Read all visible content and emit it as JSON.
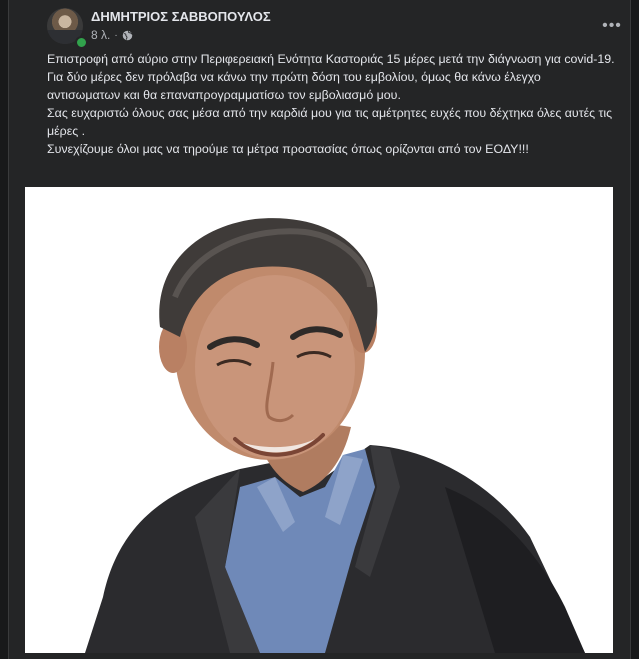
{
  "post": {
    "author": "ΔΗΜΗΤΡΙΟΣ ΣΑΒΒΟΠΟΥΛΟΣ",
    "time": "8 λ.",
    "separator": "·",
    "privacy_icon": "globe-icon",
    "more_icon": "more-options-icon",
    "more_label": "•••",
    "paragraphs": [
      "Επιστροφή από αύριο στην Περιφερειακή Ενότητα Καστοριάς 15 μέρες μετά την διάγνωση για covid-19.",
      "Για δύο μέρες δεν πρόλαβα να κάνω την πρώτη δόση του εμβολίου, όμως θα κάνω έλεγχο αντισωματων και θα επαναπρογραμματίσω τον εμβολιασμό μου.",
      "Σας ευχαριστώ όλους σας μέσα από την καρδιά μου για τις αμέτρητες ευχές που δέχτηκα όλες αυτές τις μέρες .",
      "Συνεχίζουμε όλοι μας να τηρούμε τα μέτρα προστασίας όπως ορίζονται από τον ΕΟΔΥ!!!"
    ]
  },
  "colors": {
    "page_bg": "#18191a",
    "card_bg": "#242526",
    "text_primary": "#e4e6eb",
    "text_secondary": "#b0b3b8",
    "online": "#31a24c"
  }
}
